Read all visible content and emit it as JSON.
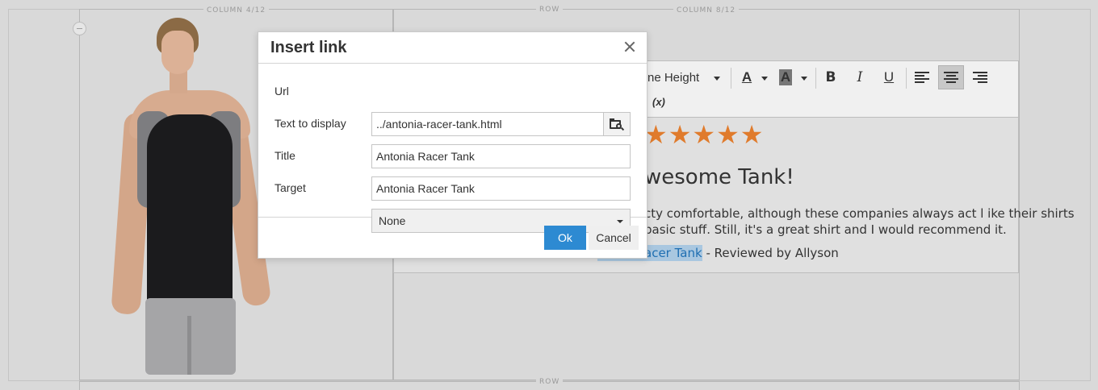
{
  "grid": {
    "column_left_label": "COLUMN 4/12",
    "row_label_top": "ROW",
    "column_right_label": "COLUMN 8/12",
    "row_label_bottom": "ROW"
  },
  "toolbar": {
    "line_height_label": "ne Height",
    "bold_label": "B",
    "italic_label": "I",
    "underline_label": "U",
    "font_color_label": "A",
    "background_color_label": "A",
    "variable_label": "(x)",
    "icons": [
      "font-color-icon",
      "background-color-icon",
      "bold-icon",
      "italic-icon",
      "underline-icon",
      "align-left-icon",
      "align-center-icon",
      "align-right-icon",
      "insert-variable-icon"
    ],
    "active_alignment": "center"
  },
  "review": {
    "stars": "★★★★★",
    "star_color": "#e07b2c",
    "title": "wesome Tank!",
    "body_line1": "cty comfortable, although these companies always act l ike their shirts",
    "body_line2": "basic stuff.  Still, it's a great shirt and I would recommend it.",
    "link_text": "acer Tank",
    "byline": " - Reviewed by Allyson"
  },
  "dialog": {
    "title": "Insert link",
    "close_icon": "close-icon",
    "fields": {
      "url_label": "Url",
      "url_value": "../antonia-racer-tank.html",
      "text_label": "Text to display",
      "text_value": "Antonia Racer Tank",
      "title_label": "Title",
      "title_value": "Antonia Racer Tank",
      "target_label": "Target",
      "target_value": "None"
    },
    "browse_icon": "browse-icon",
    "ok_label": "Ok",
    "cancel_label": "Cancel",
    "ok_color": "#2d8ad2"
  }
}
